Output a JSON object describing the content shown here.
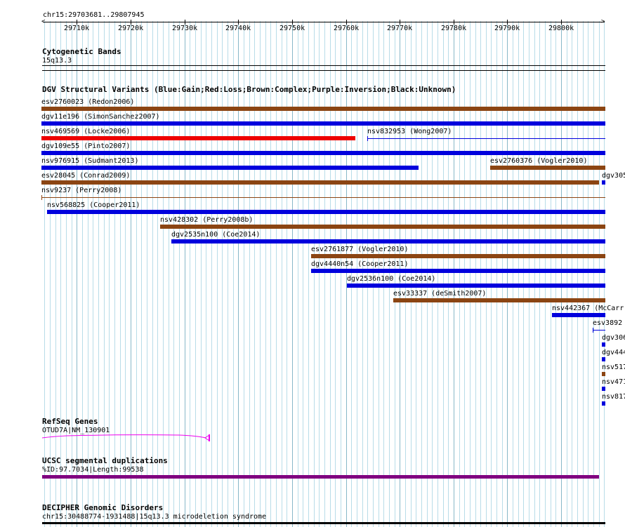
{
  "ruler": {
    "coordinates": "chr15:29703681..29807945",
    "ticks": [
      {
        "label": "29710k",
        "pos": 29710000
      },
      {
        "label": "29720k",
        "pos": 29720000
      },
      {
        "label": "29730k",
        "pos": 29730000
      },
      {
        "label": "29740k",
        "pos": 29740000
      },
      {
        "label": "29750k",
        "pos": 29750000
      },
      {
        "label": "29760k",
        "pos": 29760000
      },
      {
        "label": "29770k",
        "pos": 29770000
      },
      {
        "label": "29780k",
        "pos": 29780000
      },
      {
        "label": "29790k",
        "pos": 29790000
      },
      {
        "label": "29800k",
        "pos": 29800000
      }
    ]
  },
  "tracks": {
    "cytoband": {
      "title": "Cytogenetic Bands",
      "band_label": "15q13.3"
    },
    "dgv": {
      "title": "DGV Structural Variants (Blue:Gain;Red:Loss;Brown:Complex;Purple:Inversion;Black:Unknown)",
      "features": [
        {
          "id": "esv2760023",
          "label": "esv2760023 (Redon2006)",
          "start": 29700000,
          "end": 29900000,
          "color": "#8b4513",
          "thin": false
        },
        {
          "id": "dgv11e196",
          "label": "dgv11e196 (SimonSanchez2007)",
          "start": 29700000,
          "end": 29900000,
          "color": "#0000dd",
          "thin": false
        },
        {
          "id": "nsv469569",
          "label": "nsv469569 (Locke2006)",
          "start": 29700000,
          "end": 29761700,
          "color": "#ee0000",
          "thin": false
        },
        {
          "id": "nsv832953",
          "label": "nsv832953 (Wong2007)",
          "start": 29764000,
          "end": 29900000,
          "color": "#0000dd",
          "thin": true
        },
        {
          "id": "dgv109e55",
          "label": "dgv109e55 (Pinto2007)",
          "start": 29700000,
          "end": 29900000,
          "color": "#0000dd",
          "thin": false
        },
        {
          "id": "nsv976915",
          "label": "nsv976915 (Sudmant2013)",
          "start": 29700000,
          "end": 29773500,
          "color": "#0000dd",
          "thin": false
        },
        {
          "id": "esv2760376",
          "label": "esv2760376 (Vogler2010)",
          "start": 29786800,
          "end": 29900000,
          "color": "#8b4513",
          "thin": false
        },
        {
          "id": "esv28045",
          "label": "esv28045 (Conrad2009)",
          "start": 29700000,
          "end": 29807000,
          "color": "#8b4513",
          "thin": false
        },
        {
          "id": "dgv305",
          "label": "dgv305",
          "start": 29807500,
          "end": 29900000,
          "color": "#0000dd",
          "thin": false
        },
        {
          "id": "nsv9237",
          "label": "nsv9237 (Perry2008)",
          "start": 29700000,
          "end": 29900000,
          "color": "#8b4513",
          "thin": true
        },
        {
          "id": "nsv568825",
          "label": "nsv568825 (Cooper2011)",
          "start": 29704500,
          "end": 29900000,
          "color": "#0000dd",
          "thin": false
        },
        {
          "id": "nsv428302",
          "label": "nsv428302 (Perry2008b)",
          "start": 29725500,
          "end": 29900000,
          "color": "#8b4513",
          "thin": false
        },
        {
          "id": "dgv2535n100",
          "label": "dgv2535n100 (Coe2014)",
          "start": 29727500,
          "end": 29900000,
          "color": "#0000dd",
          "thin": false
        },
        {
          "id": "esv2761877",
          "label": "esv2761877 (Vogler2010)",
          "start": 29753500,
          "end": 29900000,
          "color": "#8b4513",
          "thin": false
        },
        {
          "id": "dgv4440n54",
          "label": "dgv4440n54 (Cooper2011)",
          "start": 29753500,
          "end": 29900000,
          "color": "#0000dd",
          "thin": false
        },
        {
          "id": "dgv2536n100",
          "label": "dgv2536n100 (Coe2014)",
          "start": 29760200,
          "end": 29900000,
          "color": "#0000dd",
          "thin": false
        },
        {
          "id": "esv33337",
          "label": "esv33337 (deSmith2007)",
          "start": 29768800,
          "end": 29900000,
          "color": "#8b4513",
          "thin": false
        },
        {
          "id": "nsv442367",
          "label": "nsv442367 (McCarr",
          "start": 29798300,
          "end": 29900000,
          "color": "#0000dd",
          "thin": false
        },
        {
          "id": "esv3892",
          "label": "esv3892",
          "start": 29805800,
          "end": 29900000,
          "color": "#0000dd",
          "thin": true
        },
        {
          "id": "dgv306",
          "label": "dgv306",
          "start": 29807500,
          "end": 29900000,
          "color": "#0000dd",
          "thin": false
        },
        {
          "id": "dgv444",
          "label": "dgv444",
          "start": 29807500,
          "end": 29900000,
          "color": "#0000dd",
          "thin": false
        },
        {
          "id": "nsv517",
          "label": "nsv517",
          "start": 29807500,
          "end": 29900000,
          "color": "#8b4513",
          "thin": false
        },
        {
          "id": "nsv471",
          "label": "nsv471",
          "start": 29807500,
          "end": 29900000,
          "color": "#0000dd",
          "thin": false
        },
        {
          "id": "nsv817",
          "label": "nsv817",
          "start": 29807500,
          "end": 29900000,
          "color": "#0000dd",
          "thin": false
        }
      ]
    },
    "refseq": {
      "title": "RefSeq Genes",
      "gene_label": "OTUD7A|NM_130901",
      "gene_color": "#ee00ee"
    },
    "segdup": {
      "title": "UCSC segmental duplications",
      "feature_label": "%ID:97.7034|Length:99538",
      "color": "#800080"
    },
    "decipher": {
      "title": "DECIPHER Genomic Disorders",
      "feature_label": "chr15:30488774-1931488|15q13.3 microdeletion syndrome"
    }
  }
}
